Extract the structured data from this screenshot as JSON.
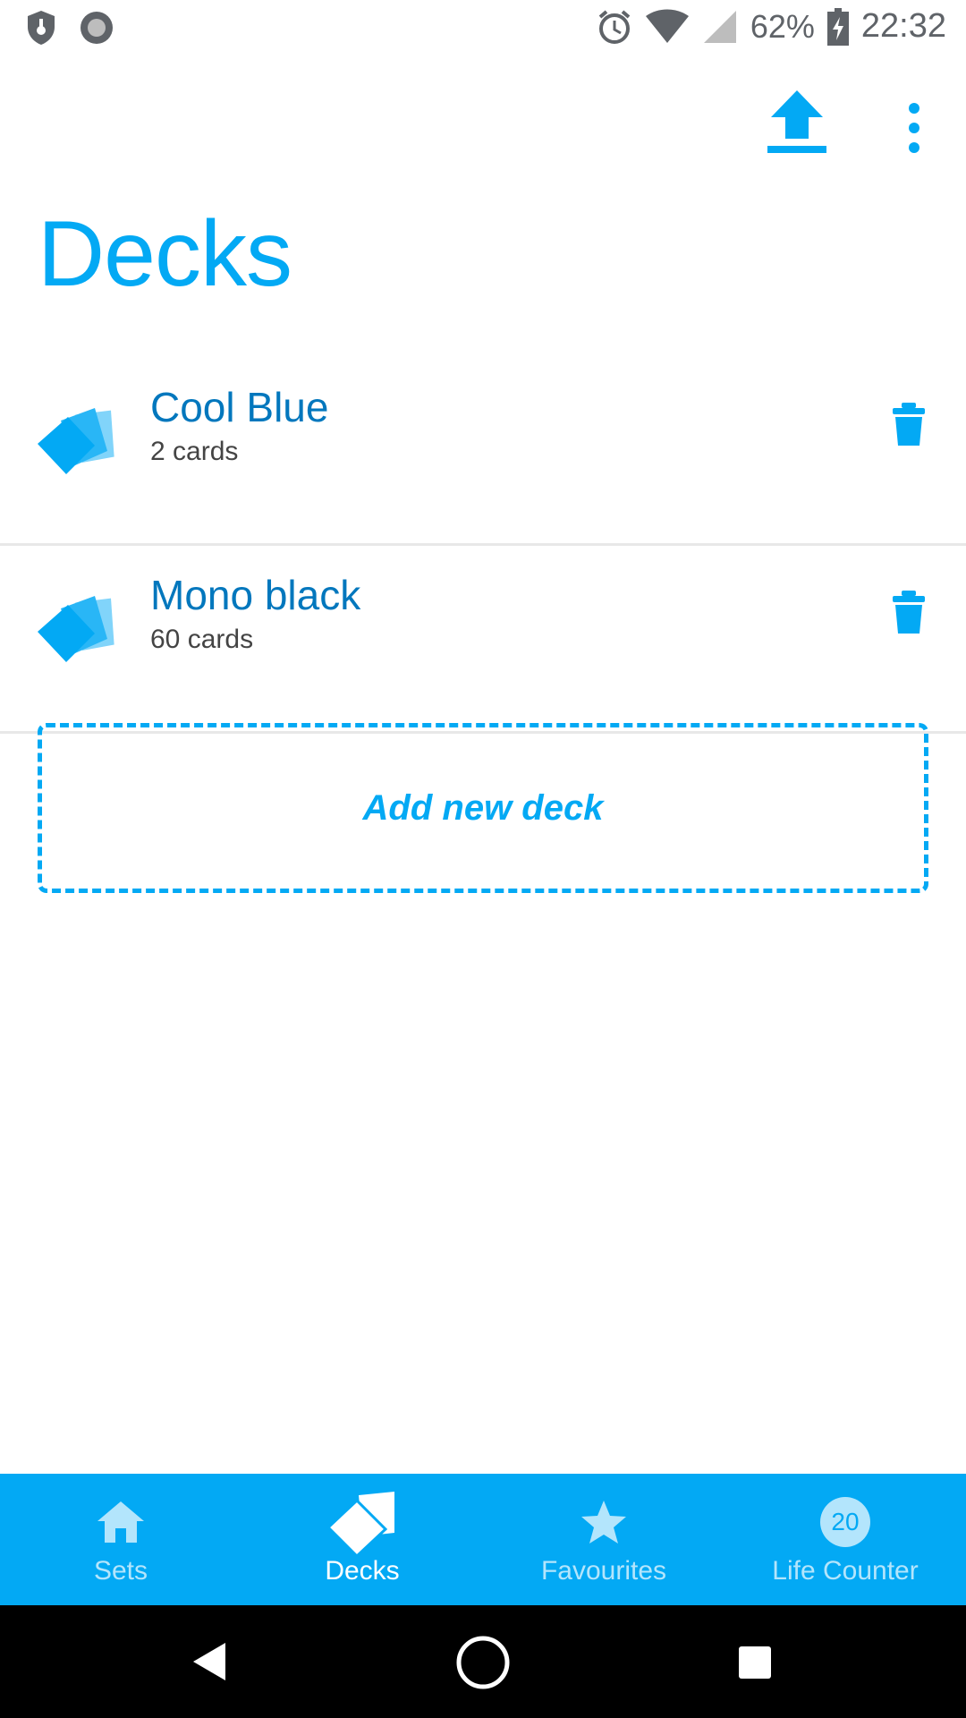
{
  "status_bar": {
    "battery": "62%",
    "time": "22:32"
  },
  "app": {
    "title": "Decks",
    "accent_color": "#03a9f4"
  },
  "decks": [
    {
      "name": "Cool Blue",
      "count": "2 cards"
    },
    {
      "name": "Mono black",
      "count": "60 cards"
    }
  ],
  "add_deck_label": "Add new deck",
  "bottom_nav": {
    "items": [
      {
        "label": "Sets",
        "icon": "home-icon"
      },
      {
        "label": "Decks",
        "icon": "cards-icon",
        "active": true
      },
      {
        "label": "Favourites",
        "icon": "star-icon"
      },
      {
        "label": "Life Counter",
        "icon": "life-counter-icon",
        "badge": "20"
      }
    ]
  }
}
